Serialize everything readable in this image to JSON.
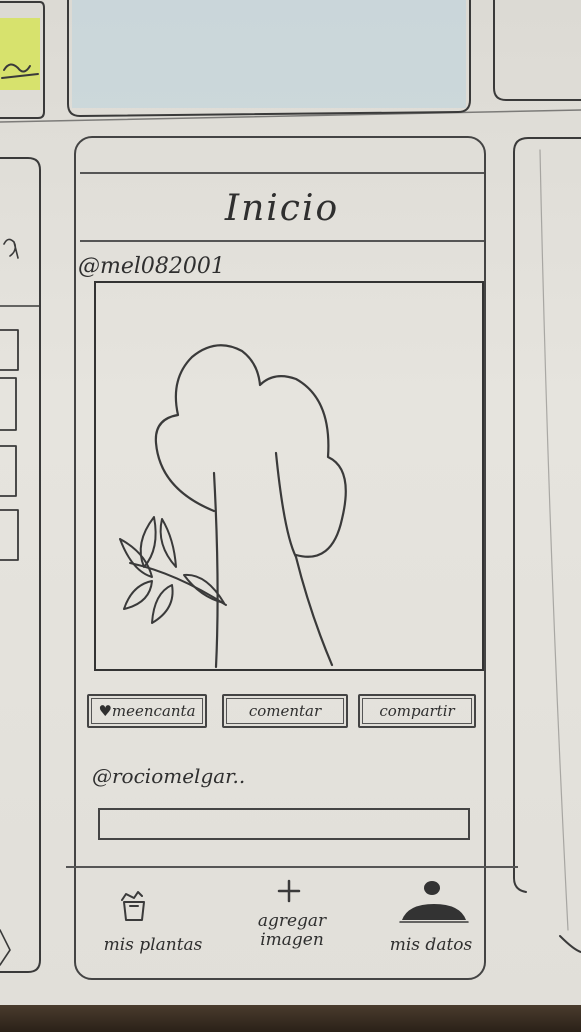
{
  "screen": {
    "title": "Inicio",
    "post": {
      "username": "@mel082001",
      "image_alt": "tree"
    },
    "actions": {
      "like": "meencanta",
      "comment": "comentar",
      "share": "compartir"
    },
    "comment": {
      "username": "@rociomelgar..",
      "input_value": ""
    },
    "bottom_nav": {
      "my_plants": "mis plantas",
      "add_image": "agregar imagen",
      "my_data": "mis datos"
    }
  }
}
